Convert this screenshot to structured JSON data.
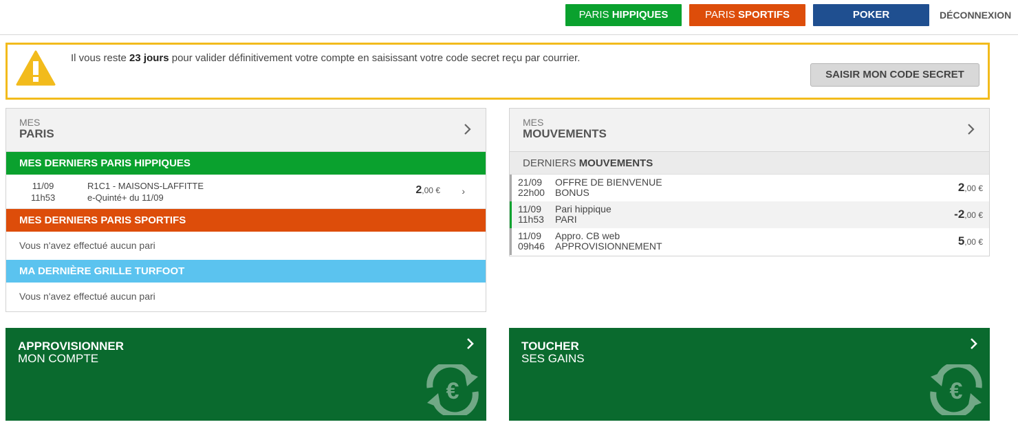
{
  "nav": {
    "hippiques": {
      "prefix": "PARIS ",
      "strong": "HIPPIQUES"
    },
    "sportifs": {
      "prefix": "PARIS ",
      "strong": "SPORTIFS"
    },
    "poker": "POKER",
    "logout": "DÉCONNEXION"
  },
  "alert": {
    "text_before": "Il vous reste ",
    "text_strong": "23 jours",
    "text_after": " pour valider définitivement votre compte en saisissant votre code secret reçu par courrier.",
    "button": "SAISIR MON CODE SECRET"
  },
  "paris": {
    "head_small": "MES",
    "head_big": "PARIS",
    "hippiques_title": "MES DERNIERS PARIS HIPPIQUES",
    "bet": {
      "date": "11/09",
      "time": "11h53",
      "line1": "R1C1 - MAISONS-LAFFITTE",
      "line2": "e-Quinté+ du 11/09",
      "amount_int": "2",
      "amount_dec": ",00 €"
    },
    "sportifs_title": "MES DERNIERS PARIS SPORTIFS",
    "sportifs_empty": "Vous n'avez effectué aucun pari",
    "turfoot_title": "MA DERNIÈRE GRILLE TURFOOT",
    "turfoot_empty": "Vous n'avez effectué aucun pari"
  },
  "mouvements": {
    "head_small": "MES",
    "head_big": "MOUVEMENTS",
    "title_light": "DERNIERS ",
    "title_strong": "MOUVEMENTS",
    "rows": [
      {
        "date": "21/09",
        "time": "22h00",
        "label": "OFFRE DE BIENVENUE",
        "type": "BONUS",
        "amount_int": "2",
        "amount_dec": ",00 €"
      },
      {
        "date": "11/09",
        "time": "11h53",
        "label": "Pari hippique",
        "type": "PARI",
        "amount_int": "-2",
        "amount_dec": ",00 €"
      },
      {
        "date": "11/09",
        "time": "09h46",
        "label": "Appro. CB web",
        "type": "APPROVISIONNEMENT",
        "amount_int": "5",
        "amount_dec": ",00 €"
      }
    ]
  },
  "tiles": {
    "appro": {
      "line1": "APPROVISIONNER",
      "line2": "MON COMPTE"
    },
    "toucher": {
      "line1": "TOUCHER",
      "line2": "SES GAINS"
    }
  },
  "colors": {
    "green": "#0aa12e",
    "orange": "#dd4d0a",
    "poker_blue": "#1f4f90",
    "turfoot_blue": "#5bc3ef",
    "alert_yellow": "#f2bb1c",
    "tile_green": "#0a6a2e"
  },
  "icons": [
    "warning-icon",
    "chevron-right-icon",
    "euro-exchange-icon"
  ]
}
